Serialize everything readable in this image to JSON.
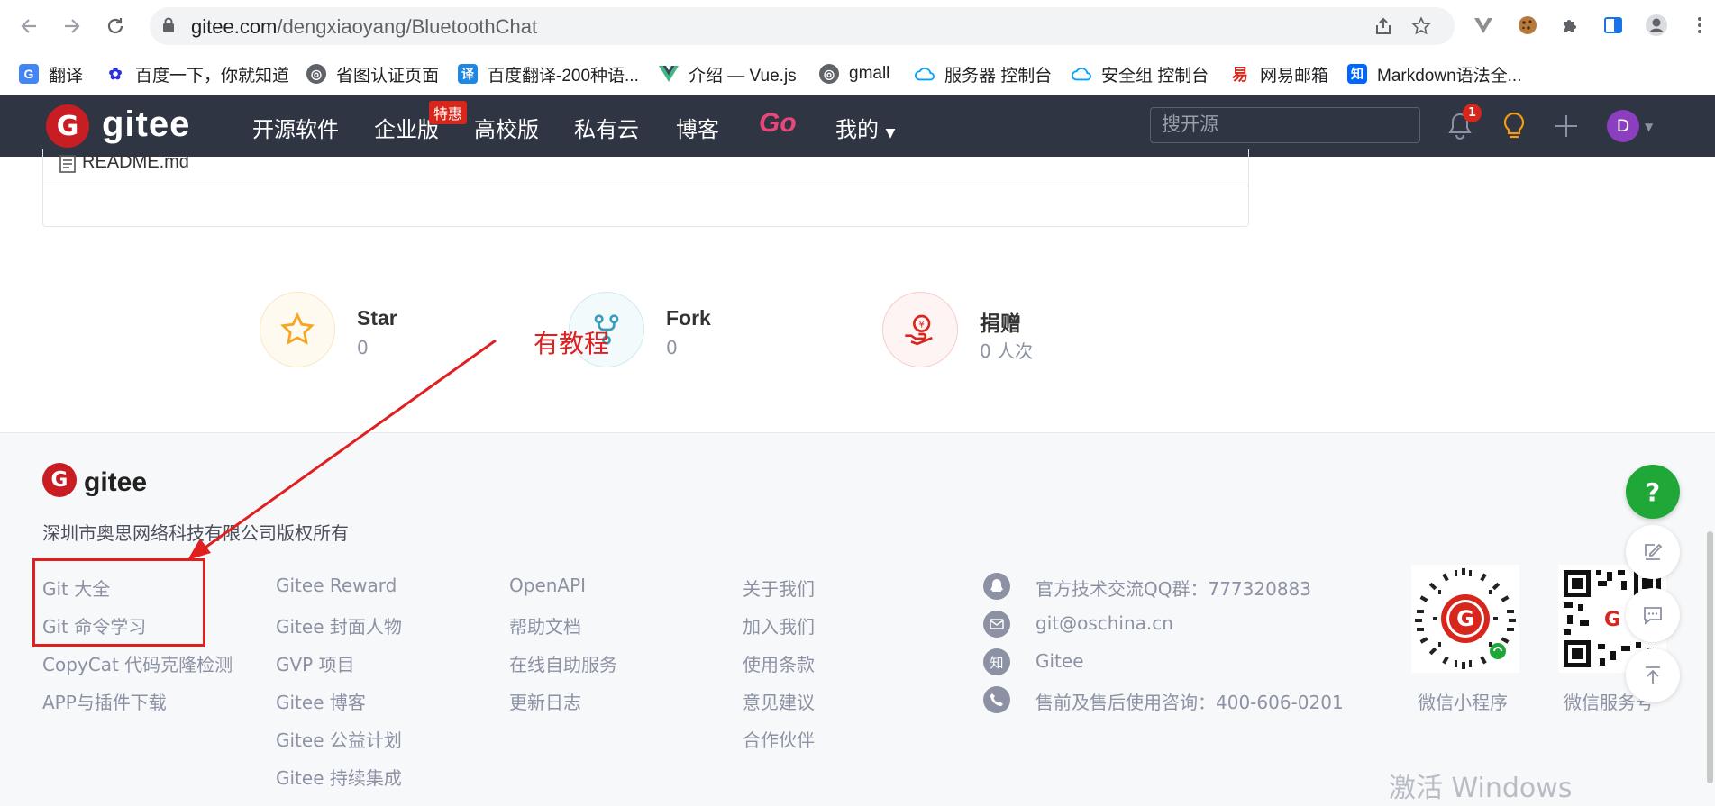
{
  "browser": {
    "url_host": "gitee.com",
    "url_path": "/dengxiaoyang/BluetoothChat",
    "bookmarks": [
      {
        "label": "翻译",
        "icon": "google-translate-icon",
        "color": "#4285f4",
        "glyph": "G"
      },
      {
        "label": "百度一下，你就知道",
        "icon": "baidu-paw-icon",
        "color": "#2932e1",
        "glyph": "🐾"
      },
      {
        "label": "省图认证页面",
        "icon": "globe-icon",
        "color": "#5f6368",
        "glyph": "◎"
      },
      {
        "label": "百度翻译-200种语...",
        "icon": "baidu-translate-icon",
        "color": "#1e88e5",
        "glyph": "译"
      },
      {
        "label": "介绍 — Vue.js",
        "icon": "vue-icon",
        "color": "#41b883",
        "glyph": "V"
      },
      {
        "label": "gmall",
        "icon": "globe-icon",
        "color": "#5f6368",
        "glyph": "◎"
      },
      {
        "label": "服务器 控制台",
        "icon": "cloud-icon",
        "color": "#00a3ff",
        "glyph": "☁"
      },
      {
        "label": "安全组 控制台",
        "icon": "cloud-icon",
        "color": "#00a3ff",
        "glyph": "☁"
      },
      {
        "label": "网易邮箱",
        "icon": "netease-icon",
        "color": "#d7261b",
        "glyph": "易"
      },
      {
        "label": "Markdown语法全...",
        "icon": "zhihu-icon",
        "color": "#0066ff",
        "glyph": "知"
      }
    ]
  },
  "header": {
    "brand": "gitee",
    "nav": [
      "开源软件",
      "企业版",
      "高校版",
      "私有云",
      "博客"
    ],
    "promo_badge": "特惠",
    "go_label": "Go",
    "mine_label": "我的",
    "search_placeholder": "搜开源",
    "notification_count": "1",
    "avatar_initial": "D",
    "accent": "#c71d23",
    "bar_color": "#2f3542"
  },
  "readme": {
    "label": "README.md"
  },
  "stats": [
    {
      "title": "Star",
      "value": "0",
      "icon": "star-icon"
    },
    {
      "title": "Fork",
      "value": "0",
      "icon": "fork-icon"
    },
    {
      "title": "捐赠",
      "value": "0 人次",
      "icon": "donate-icon"
    }
  ],
  "annotation": {
    "text": "有教程",
    "color": "#e02020"
  },
  "footer": {
    "brand": "gitee",
    "copyright": "深圳市奥思网络科技有限公司版权所有",
    "col1": [
      "Git 大全",
      "Git 命令学习",
      "CopyCat 代码克隆检测",
      "APP与插件下载"
    ],
    "col2": [
      "Gitee Reward",
      "Gitee 封面人物",
      "GVP 项目",
      "Gitee 博客",
      "Gitee 公益计划",
      "Gitee 持续集成"
    ],
    "col3": [
      "OpenAPI",
      "帮助文档",
      "在线自助服务",
      "更新日志"
    ],
    "col4": [
      "关于我们",
      "加入我们",
      "使用条款",
      "意见建议",
      "合作伙伴"
    ],
    "contacts": [
      {
        "text": "官方技术交流QQ群：777320883",
        "icon": "qq-icon"
      },
      {
        "text": "git@oschina.cn",
        "icon": "mail-icon"
      },
      {
        "text": "Gitee",
        "icon": "zhihu-icon"
      },
      {
        "text": "售前及售后使用咨询：400-606-0201",
        "icon": "phone-icon"
      }
    ],
    "qr_labels": [
      "微信小程序",
      "微信服务号"
    ]
  },
  "watermark": "激活 Windows"
}
